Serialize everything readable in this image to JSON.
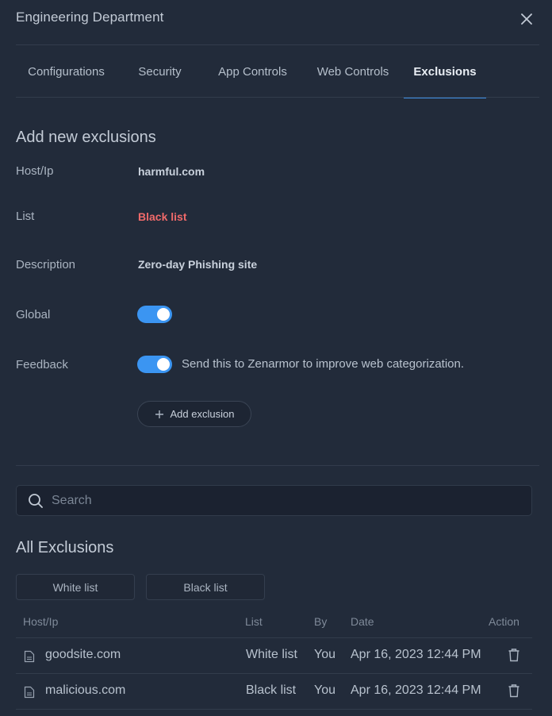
{
  "header": {
    "title": "Engineering Department",
    "close_icon": "close-icon"
  },
  "tabs": [
    {
      "label": "Configurations",
      "active": false
    },
    {
      "label": "Security",
      "active": false
    },
    {
      "label": "App Controls",
      "active": false
    },
    {
      "label": "Web Controls",
      "active": false
    },
    {
      "label": "Exclusions",
      "active": true
    }
  ],
  "form": {
    "section_title": "Add new exclusions",
    "host_label": "Host/Ip",
    "host_value": "harmful.com",
    "list_label": "List",
    "list_value": "Black list",
    "description_label": "Description",
    "description_value": "Zero-day Phishing site",
    "global_label": "Global",
    "global_on": true,
    "feedback_label": "Feedback",
    "feedback_on": true,
    "feedback_text": "Send this to Zenarmor to improve web categorization.",
    "add_button_label": "Add exclusion"
  },
  "search": {
    "placeholder": "Search"
  },
  "exclusions": {
    "section_title": "All Exclusions",
    "filters": [
      "White list",
      "Black list"
    ],
    "columns": [
      "Host/Ip",
      "List",
      "By",
      "Date",
      "Action"
    ],
    "rows": [
      {
        "host": "goodsite.com",
        "list": "White list",
        "by": "You",
        "date": "Apr 16, 2023 12:44 PM"
      },
      {
        "host": "malicious.com",
        "list": "Black list",
        "by": "You",
        "date": "Apr 16, 2023 12:44 PM"
      }
    ]
  },
  "colors": {
    "background": "#222b3a",
    "accent": "#3b95f2",
    "black_list": "#f06a6a",
    "white_list": "#6cc64a"
  }
}
